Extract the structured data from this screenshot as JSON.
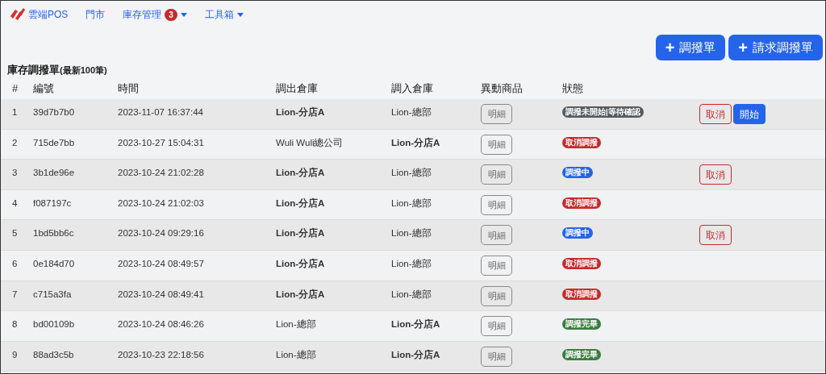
{
  "navbar": {
    "brand": "雲端POS",
    "items": [
      {
        "label": "門市",
        "dropdown": false
      },
      {
        "label": "庫存管理",
        "badge": "3",
        "dropdown": true
      },
      {
        "label": "工具箱",
        "dropdown": true
      }
    ]
  },
  "actions": [
    {
      "icon": "+",
      "label": "調撥單"
    },
    {
      "icon": "+",
      "label": "請求調撥單"
    }
  ],
  "title": {
    "main": "庫存調撥單",
    "sub": "(最新100筆)"
  },
  "table": {
    "columns": [
      "#",
      "編號",
      "時間",
      "調出倉庫",
      "調入倉庫",
      "異動商品",
      "狀態"
    ],
    "rows": [
      {
        "index": "1",
        "code": "39d7b7b0",
        "time": "2023-11-07 16:37:44",
        "from": {
          "text": "Lion-分店A",
          "emphasized": true
        },
        "to": {
          "text": "Lion-總部",
          "emphasized": false
        },
        "detail": "明細",
        "status": {
          "text": "調撥未開始|等待確認",
          "color": "#555b61"
        },
        "buttons": [
          {
            "kind": "cancel",
            "label": "取消"
          },
          {
            "kind": "start",
            "label": "開始"
          }
        ]
      },
      {
        "index": "2",
        "code": "715de7bb",
        "time": "2023-10-27 15:04:31",
        "from": {
          "text": "Wuli Wuli總公司",
          "emphasized": false
        },
        "to": {
          "text": "Lion-分店A",
          "emphasized": true
        },
        "detail": "明細",
        "status": {
          "text": "取消調撥",
          "color": "#c62b2b"
        },
        "buttons": []
      },
      {
        "index": "3",
        "code": "3b1de96e",
        "time": "2023-10-24 21:02:28",
        "from": {
          "text": "Lion-分店A",
          "emphasized": true
        },
        "to": {
          "text": "Lion-總部",
          "emphasized": false
        },
        "detail": "明細",
        "status": {
          "text": "調撥中",
          "color": "#2563eb"
        },
        "buttons": [
          {
            "kind": "cancel",
            "label": "取消"
          }
        ]
      },
      {
        "index": "4",
        "code": "f087197c",
        "time": "2023-10-24 21:02:03",
        "from": {
          "text": "Lion-分店A",
          "emphasized": true
        },
        "to": {
          "text": "Lion-總部",
          "emphasized": false
        },
        "detail": "明細",
        "status": {
          "text": "取消調撥",
          "color": "#c62b2b"
        },
        "buttons": []
      },
      {
        "index": "5",
        "code": "1bd5bb6c",
        "time": "2023-10-24 09:29:16",
        "from": {
          "text": "Lion-分店A",
          "emphasized": true
        },
        "to": {
          "text": "Lion-總部",
          "emphasized": false
        },
        "detail": "明細",
        "status": {
          "text": "調撥中",
          "color": "#2563eb"
        },
        "buttons": [
          {
            "kind": "cancel",
            "label": "取消"
          }
        ]
      },
      {
        "index": "6",
        "code": "0e184d70",
        "time": "2023-10-24 08:49:57",
        "from": {
          "text": "Lion-分店A",
          "emphasized": true
        },
        "to": {
          "text": "Lion-總部",
          "emphasized": false
        },
        "detail": "明細",
        "status": {
          "text": "取消調撥",
          "color": "#c62b2b"
        },
        "buttons": []
      },
      {
        "index": "7",
        "code": "c715a3fa",
        "time": "2023-10-24 08:49:41",
        "from": {
          "text": "Lion-分店A",
          "emphasized": true
        },
        "to": {
          "text": "Lion-總部",
          "emphasized": false
        },
        "detail": "明細",
        "status": {
          "text": "取消調撥",
          "color": "#c62b2b"
        },
        "buttons": []
      },
      {
        "index": "8",
        "code": "bd00109b",
        "time": "2023-10-24 08:46:26",
        "from": {
          "text": "Lion-總部",
          "emphasized": false
        },
        "to": {
          "text": "Lion-分店A",
          "emphasized": true
        },
        "detail": "明細",
        "status": {
          "text": "調撥完畢",
          "color": "#3a7d3e"
        },
        "buttons": []
      },
      {
        "index": "9",
        "code": "88ad3c5b",
        "time": "2023-10-23 22:18:56",
        "from": {
          "text": "Lion-總部",
          "emphasized": false
        },
        "to": {
          "text": "Lion-分店A",
          "emphasized": true
        },
        "detail": "明細",
        "status": {
          "text": "調撥完畢",
          "color": "#3a7d3e"
        },
        "buttons": []
      }
    ]
  }
}
